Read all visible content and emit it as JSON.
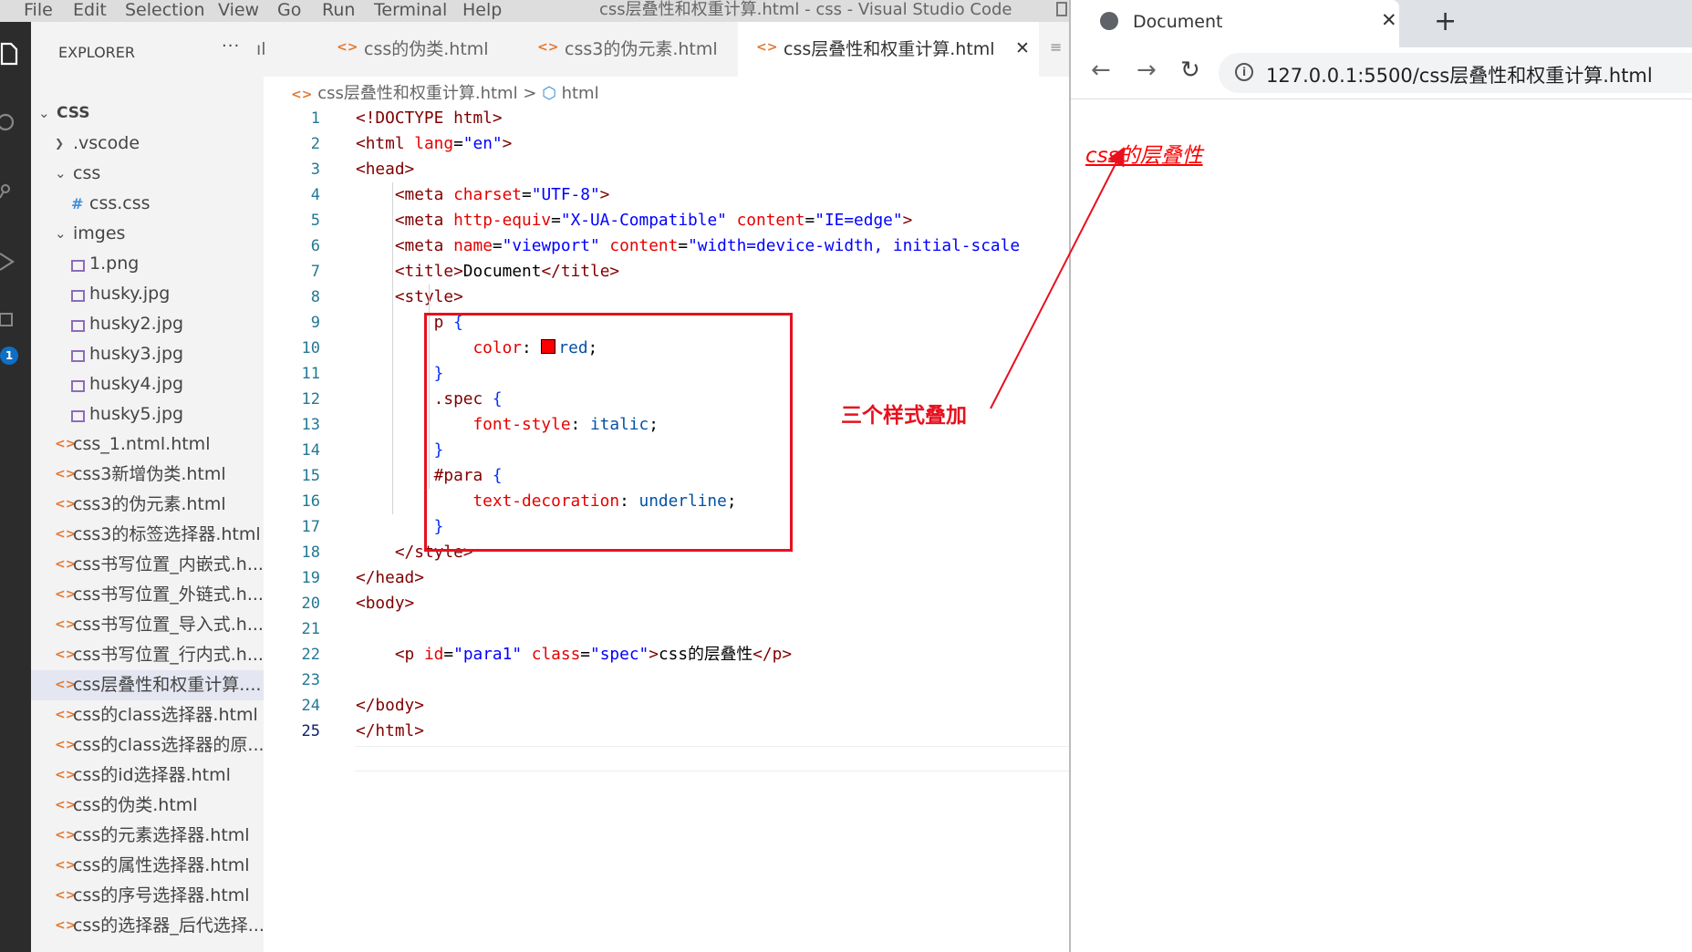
{
  "menubar": {
    "items": [
      "File",
      "Edit",
      "Selection",
      "View",
      "Go",
      "Run",
      "Terminal",
      "Help"
    ],
    "title": "css层叠性和权重计算.html - css - Visual Studio Code"
  },
  "activity": {
    "badge": "1"
  },
  "explorer": {
    "title": "EXPLORER",
    "more": "···",
    "tree": [
      {
        "label": "CSS",
        "type": "root"
      },
      {
        "label": ".vscode",
        "type": "folder-collapsed"
      },
      {
        "label": "css",
        "type": "folder-open"
      },
      {
        "label": "css.css",
        "type": "css"
      },
      {
        "label": "imges",
        "type": "folder-open"
      },
      {
        "label": "1.png",
        "type": "img"
      },
      {
        "label": "husky.jpg",
        "type": "img"
      },
      {
        "label": "husky2.jpg",
        "type": "img"
      },
      {
        "label": "husky3.jpg",
        "type": "img"
      },
      {
        "label": "husky4.jpg",
        "type": "img"
      },
      {
        "label": "husky5.jpg",
        "type": "img"
      },
      {
        "label": "css_1.ntml.html",
        "type": "html"
      },
      {
        "label": "css3新增伪类.html",
        "type": "html"
      },
      {
        "label": "css3的伪元素.html",
        "type": "html"
      },
      {
        "label": "css3的标签选择器.html",
        "type": "html"
      },
      {
        "label": "css书写位置_内嵌式.h...",
        "type": "html"
      },
      {
        "label": "css书写位置_外链式.h...",
        "type": "html"
      },
      {
        "label": "css书写位置_导入式.h...",
        "type": "html"
      },
      {
        "label": "css书写位置_行内式.h...",
        "type": "html"
      },
      {
        "label": "css层叠性和权重计算....",
        "type": "html",
        "active": true
      },
      {
        "label": "css的class选择器.html",
        "type": "html"
      },
      {
        "label": "css的class选择器的原...",
        "type": "html"
      },
      {
        "label": "css的id选择器.html",
        "type": "html"
      },
      {
        "label": "css的伪类.html",
        "type": "html"
      },
      {
        "label": "css的元素选择器.html",
        "type": "html"
      },
      {
        "label": "css的属性选择器.html",
        "type": "html"
      },
      {
        "label": "css的序号选择器.html",
        "type": "html"
      },
      {
        "label": "css的选择器_后代选择...",
        "type": "html"
      }
    ]
  },
  "tabs": [
    {
      "label": "ıl",
      "partial": true
    },
    {
      "label": "css的伪类.html"
    },
    {
      "label": "css3的伪元素.html"
    },
    {
      "label": "css层叠性和权重计算.html",
      "active": true
    }
  ],
  "breadcrumb": {
    "file": "css层叠性和权重计算.html",
    "sep": ">",
    "symbol": "html"
  },
  "editor": {
    "line_numbers": [
      "1",
      "2",
      "3",
      "4",
      "5",
      "6",
      "7",
      "8",
      "9",
      "10",
      "11",
      "12",
      "13",
      "14",
      "15",
      "16",
      "17",
      "18",
      "19",
      "20",
      "21",
      "22",
      "23",
      "24",
      "25"
    ],
    "lines": [
      [
        [
          "t-br",
          "<!DOCTYPE "
        ],
        [
          "t-tag",
          "html"
        ],
        [
          "t-br",
          ">"
        ]
      ],
      [
        [
          "t-br",
          "<"
        ],
        [
          "t-tag",
          "html "
        ],
        [
          "t-attr",
          "lang"
        ],
        [
          "t-pun",
          "="
        ],
        [
          "t-str",
          "\"en\""
        ],
        [
          "t-br",
          ">"
        ]
      ],
      [
        [
          "t-br",
          "<"
        ],
        [
          "t-tag",
          "head"
        ],
        [
          "t-br",
          ">"
        ]
      ],
      [
        [
          "t-pun",
          "    "
        ],
        [
          "t-br",
          "<"
        ],
        [
          "t-tag",
          "meta "
        ],
        [
          "t-attr",
          "charset"
        ],
        [
          "t-pun",
          "="
        ],
        [
          "t-str",
          "\"UTF-8\""
        ],
        [
          "t-br",
          ">"
        ]
      ],
      [
        [
          "t-pun",
          "    "
        ],
        [
          "t-br",
          "<"
        ],
        [
          "t-tag",
          "meta "
        ],
        [
          "t-attr",
          "http-equiv"
        ],
        [
          "t-pun",
          "="
        ],
        [
          "t-str",
          "\"X-UA-Compatible\""
        ],
        [
          "t-pun",
          " "
        ],
        [
          "t-attr",
          "content"
        ],
        [
          "t-pun",
          "="
        ],
        [
          "t-str",
          "\"IE=edge\""
        ],
        [
          "t-br",
          ">"
        ]
      ],
      [
        [
          "t-pun",
          "    "
        ],
        [
          "t-br",
          "<"
        ],
        [
          "t-tag",
          "meta "
        ],
        [
          "t-attr",
          "name"
        ],
        [
          "t-pun",
          "="
        ],
        [
          "t-str",
          "\"viewport\""
        ],
        [
          "t-pun",
          " "
        ],
        [
          "t-attr",
          "content"
        ],
        [
          "t-pun",
          "="
        ],
        [
          "t-str",
          "\"width=device-width, initial-scale"
        ]
      ],
      [
        [
          "t-pun",
          "    "
        ],
        [
          "t-br",
          "<"
        ],
        [
          "t-tag",
          "title"
        ],
        [
          "t-br",
          ">"
        ],
        [
          "t-pun",
          "Document"
        ],
        [
          "t-br",
          "</"
        ],
        [
          "t-tag",
          "title"
        ],
        [
          "t-br",
          ">"
        ]
      ],
      [
        [
          "t-pun",
          "    "
        ],
        [
          "t-br",
          "<"
        ],
        [
          "t-tag",
          "style"
        ],
        [
          "t-br",
          ">"
        ]
      ],
      [
        [
          "t-pun",
          "        "
        ],
        [
          "t-sel",
          "p "
        ],
        [
          "t-brace",
          "{"
        ]
      ],
      [
        [
          "t-pun",
          "            "
        ],
        [
          "t-prop",
          "color"
        ],
        [
          "t-pun",
          ": "
        ],
        [
          "swatch",
          ""
        ],
        [
          "t-val",
          "red"
        ],
        [
          "t-pun",
          ";"
        ]
      ],
      [
        [
          "t-pun",
          "        "
        ],
        [
          "t-brace",
          "}"
        ]
      ],
      [
        [
          "t-pun",
          "        "
        ],
        [
          "t-sel",
          ".spec "
        ],
        [
          "t-brace",
          "{"
        ]
      ],
      [
        [
          "t-pun",
          "            "
        ],
        [
          "t-prop",
          "font-style"
        ],
        [
          "t-pun",
          ": "
        ],
        [
          "t-val",
          "italic"
        ],
        [
          "t-pun",
          ";"
        ]
      ],
      [
        [
          "t-pun",
          "        "
        ],
        [
          "t-brace",
          "}"
        ]
      ],
      [
        [
          "t-pun",
          "        "
        ],
        [
          "t-sel",
          "#para "
        ],
        [
          "t-brace",
          "{"
        ]
      ],
      [
        [
          "t-pun",
          "            "
        ],
        [
          "t-prop",
          "text-decoration"
        ],
        [
          "t-pun",
          ": "
        ],
        [
          "t-val",
          "underline"
        ],
        [
          "t-pun",
          ";"
        ]
      ],
      [
        [
          "t-pun",
          "        "
        ],
        [
          "t-brace",
          "}"
        ]
      ],
      [
        [
          "t-pun",
          "    "
        ],
        [
          "t-br",
          "</"
        ],
        [
          "t-tag",
          "style"
        ],
        [
          "t-br",
          ">"
        ]
      ],
      [
        [
          "t-br",
          "</"
        ],
        [
          "t-tag",
          "head"
        ],
        [
          "t-br",
          ">"
        ]
      ],
      [
        [
          "t-br",
          "<"
        ],
        [
          "t-tag",
          "body"
        ],
        [
          "t-br",
          ">"
        ]
      ],
      [],
      [
        [
          "t-pun",
          "    "
        ],
        [
          "t-br",
          "<"
        ],
        [
          "t-tag",
          "p "
        ],
        [
          "t-attr",
          "id"
        ],
        [
          "t-pun",
          "="
        ],
        [
          "t-str",
          "\"para1\""
        ],
        [
          "t-pun",
          " "
        ],
        [
          "t-attr",
          "class"
        ],
        [
          "t-pun",
          "="
        ],
        [
          "t-str",
          "\"spec\""
        ],
        [
          "t-br",
          ">"
        ],
        [
          "t-pun",
          "css的层叠性"
        ],
        [
          "t-br",
          "</"
        ],
        [
          "t-tag",
          "p"
        ],
        [
          "t-br",
          ">"
        ]
      ],
      [],
      [
        [
          "t-br",
          "</"
        ],
        [
          "t-tag",
          "body"
        ],
        [
          "t-br",
          ">"
        ]
      ],
      [
        [
          "t-br",
          "</"
        ],
        [
          "t-tag",
          "html"
        ],
        [
          "t-br",
          ">"
        ]
      ]
    ]
  },
  "annotation": {
    "text": "三个样式叠加",
    "color": "#e8101e"
  },
  "browser": {
    "tab_title": "Document",
    "tab_close": "✕",
    "new_tab": "+",
    "back": "←",
    "forward": "→",
    "reload": "↻",
    "info": "i",
    "url": "127.0.0.1:5500/css层叠性和权重计算.html",
    "paragraph": "css的层叠性"
  }
}
